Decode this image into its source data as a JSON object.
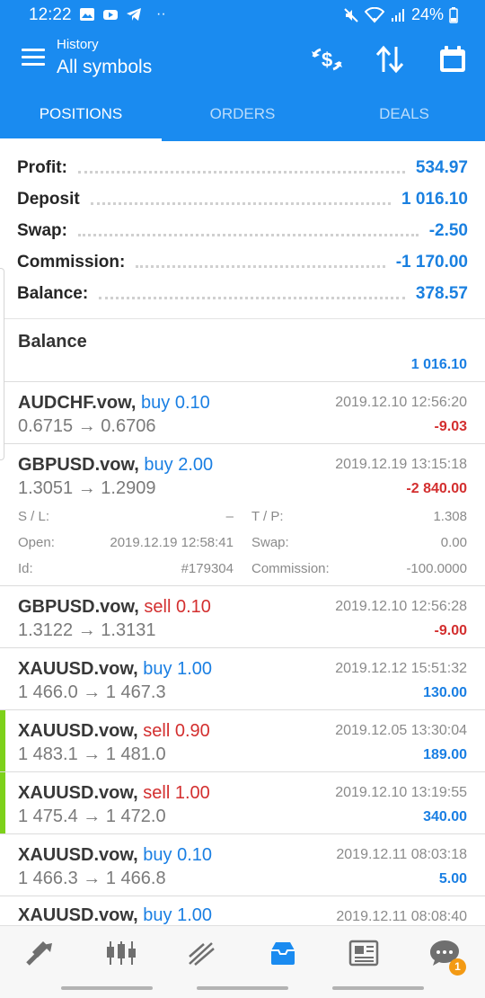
{
  "status": {
    "time": "12:22",
    "battery": "24%"
  },
  "header": {
    "subtitle": "History",
    "title": "All symbols"
  },
  "tabs": [
    {
      "label": "POSITIONS",
      "active": true
    },
    {
      "label": "ORDERS",
      "active": false
    },
    {
      "label": "DEALS",
      "active": false
    }
  ],
  "summary": [
    {
      "label": "Profit:",
      "value": "534.97"
    },
    {
      "label": "Deposit",
      "value": "1 016.10"
    },
    {
      "label": "Swap:",
      "value": "-2.50"
    },
    {
      "label": "Commission:",
      "value": "-1 170.00"
    },
    {
      "label": "Balance:",
      "value": "378.57"
    }
  ],
  "balance_entry": {
    "title": "Balance",
    "value": "1 016.10"
  },
  "positions": [
    {
      "symbol": "AUDCHF.vow,",
      "side": "buy",
      "volume": "0.10",
      "open_price": "0.6715",
      "close_price": "0.6706",
      "time": "2019.12.10 12:56:20",
      "profit": "-9.03",
      "highlight": false
    },
    {
      "symbol": "GBPUSD.vow,",
      "side": "buy",
      "volume": "2.00",
      "open_price": "1.3051",
      "close_price": "1.2909",
      "time": "2019.12.19 13:15:18",
      "profit": "-2 840.00",
      "highlight": false
    },
    {
      "symbol": "GBPUSD.vow,",
      "side": "sell",
      "volume": "0.10",
      "open_price": "1.3122",
      "close_price": "1.3131",
      "time": "2019.12.10 12:56:28",
      "profit": "-9.00",
      "highlight": false
    },
    {
      "symbol": "XAUUSD.vow,",
      "side": "buy",
      "volume": "1.00",
      "open_price": "1 466.0",
      "close_price": "1 467.3",
      "time": "2019.12.12 15:51:32",
      "profit": "130.00",
      "highlight": false
    },
    {
      "symbol": "XAUUSD.vow,",
      "side": "sell",
      "volume": "0.90",
      "open_price": "1 483.1",
      "close_price": "1 481.0",
      "time": "2019.12.05 13:30:04",
      "profit": "189.00",
      "highlight": true
    },
    {
      "symbol": "XAUUSD.vow,",
      "side": "sell",
      "volume": "1.00",
      "open_price": "1 475.4",
      "close_price": "1 472.0",
      "time": "2019.12.10 13:19:55",
      "profit": "340.00",
      "highlight": true
    },
    {
      "symbol": "XAUUSD.vow,",
      "side": "buy",
      "volume": "0.10",
      "open_price": "1 466.3",
      "close_price": "1 466.8",
      "time": "2019.12.11 08:03:18",
      "profit": "5.00",
      "highlight": false
    },
    {
      "symbol": "XAUUSD.vow,",
      "side": "buy",
      "volume": "1.00",
      "open_price": "",
      "close_price": "",
      "time": "2019.12.11 08:08:40",
      "profit": "",
      "highlight": false
    }
  ],
  "arrow": "→",
  "expanded_details": {
    "sl_label": "S / L:",
    "sl_value": "–",
    "tp_label": "T / P:",
    "tp_value": "1.308",
    "open_label": "Open:",
    "open_value": "2019.12.19 12:58:41",
    "swap_label": "Swap:",
    "swap_value": "0.00",
    "id_label": "Id:",
    "id_value": "#179304",
    "commission_label": "Commission:",
    "commission_value": "-100.0000"
  },
  "bottom_nav": {
    "items": [
      "trade-icon",
      "chart-icon",
      "market-icon",
      "history-icon",
      "news-icon",
      "chat-icon"
    ],
    "active": "history-icon",
    "chat_badge": "1"
  },
  "colors": {
    "primary": "#1a8bf0",
    "buy": "#1a7fe3",
    "sell": "#d32f2f",
    "highlight": "#7dd11a",
    "badge": "#f39a14"
  }
}
